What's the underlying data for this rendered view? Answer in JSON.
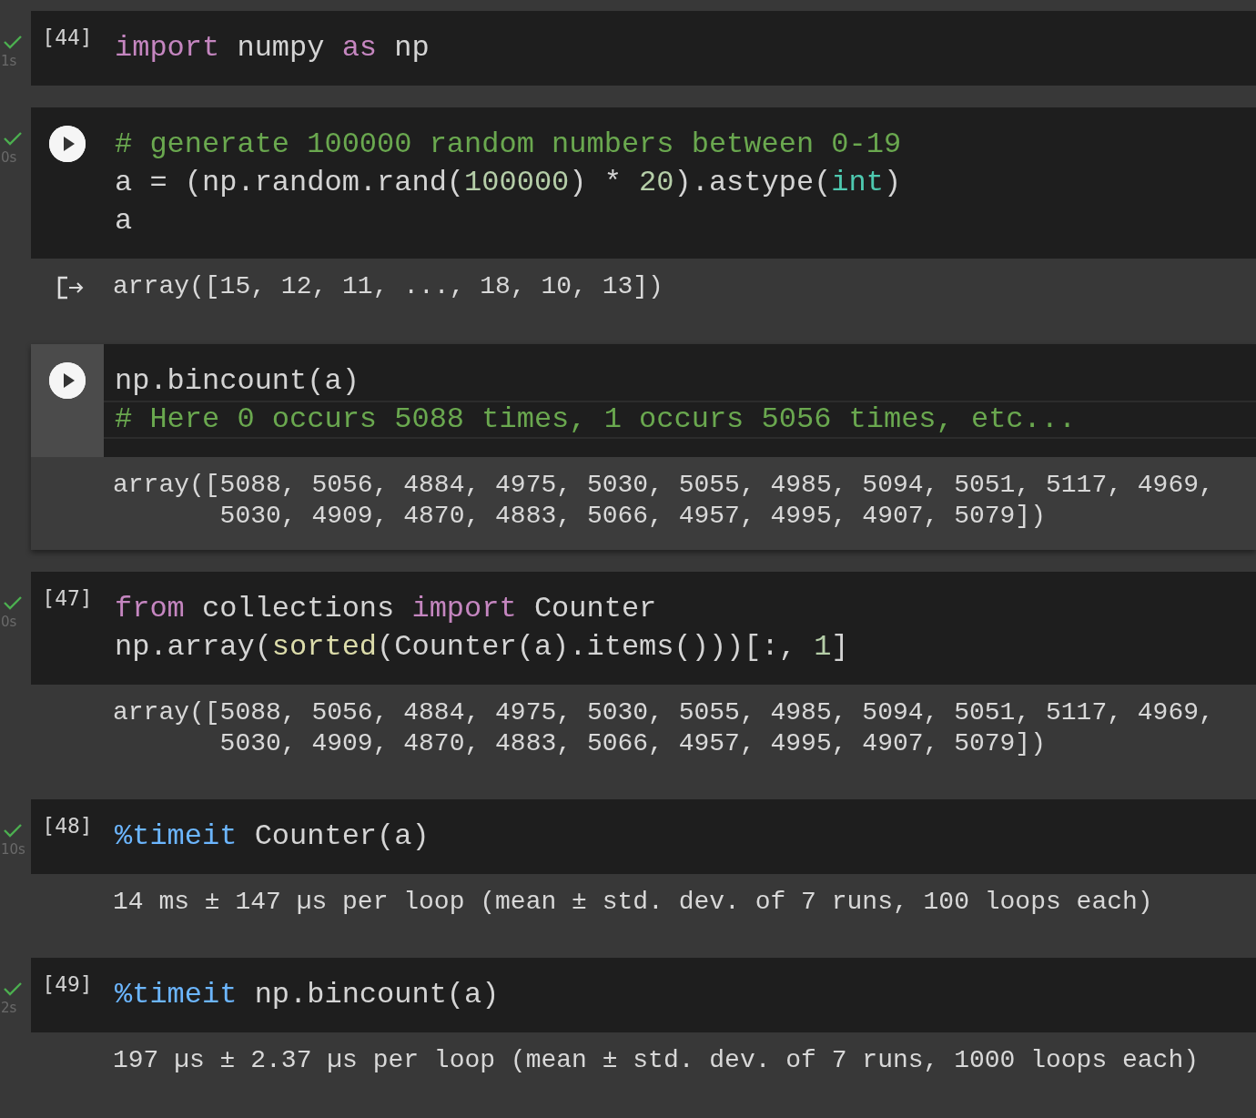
{
  "cells": [
    {
      "kind": "count",
      "count": "[44]",
      "done": true,
      "time": "1s",
      "focused": false,
      "code": [
        {
          "current": false,
          "tokens": [
            {
              "t": "import",
              "kind": "kw"
            },
            {
              "t": " numpy ",
              "kind": "plain"
            },
            {
              "t": "as",
              "kind": "kw"
            },
            {
              "t": " np",
              "kind": "plain"
            }
          ]
        }
      ]
    },
    {
      "kind": "run",
      "done": true,
      "time": "0s",
      "focused": false,
      "code": [
        {
          "current": false,
          "tokens": [
            {
              "t": "# generate 100000 random numbers between 0-19",
              "kind": "comment"
            }
          ]
        },
        {
          "current": false,
          "tokens": [
            {
              "t": "a = (np.random.rand(",
              "kind": "plain"
            },
            {
              "t": "100000",
              "kind": "num"
            },
            {
              "t": ") * ",
              "kind": "plain"
            },
            {
              "t": "20",
              "kind": "num"
            },
            {
              "t": ").astype(",
              "kind": "plain"
            },
            {
              "t": "int",
              "kind": "builtin"
            },
            {
              "t": ")",
              "kind": "plain"
            }
          ]
        },
        {
          "current": false,
          "tokens": [
            {
              "t": "a",
              "kind": "plain"
            }
          ]
        }
      ],
      "output": {
        "icon": true,
        "lines": [
          "array([15, 12, 11, ..., 18, 10, 13])"
        ]
      }
    },
    {
      "kind": "run",
      "done": false,
      "focused": true,
      "code": [
        {
          "current": false,
          "tokens": [
            {
              "t": "np.bincount(a)",
              "kind": "plain"
            }
          ]
        },
        {
          "current": true,
          "tokens": [
            {
              "t": "# Here 0 occurs 5088 times, 1 occurs 5056 times, etc...",
              "kind": "comment"
            }
          ]
        }
      ],
      "output": {
        "icon": false,
        "lines": [
          "array([5088, 5056, 4884, 4975, 5030, 5055, 4985, 5094, 5051, 5117, 4969,",
          "       5030, 4909, 4870, 4883, 5066, 4957, 4995, 4907, 5079])"
        ]
      }
    },
    {
      "kind": "count",
      "count": "[47]",
      "done": true,
      "time": "0s",
      "focused": false,
      "code": [
        {
          "current": false,
          "tokens": [
            {
              "t": "from",
              "kind": "kw"
            },
            {
              "t": " collections ",
              "kind": "plain"
            },
            {
              "t": "import",
              "kind": "kw"
            },
            {
              "t": " Counter",
              "kind": "plain"
            }
          ]
        },
        {
          "current": false,
          "tokens": [
            {
              "t": "np.array(",
              "kind": "plain"
            },
            {
              "t": "sorted",
              "kind": "func"
            },
            {
              "t": "(Counter(a).items()))[:, ",
              "kind": "plain"
            },
            {
              "t": "1",
              "kind": "num"
            },
            {
              "t": "]",
              "kind": "plain"
            }
          ]
        }
      ],
      "output": {
        "icon": false,
        "lines": [
          "array([5088, 5056, 4884, 4975, 5030, 5055, 4985, 5094, 5051, 5117, 4969,",
          "       5030, 4909, 4870, 4883, 5066, 4957, 4995, 4907, 5079])"
        ]
      }
    },
    {
      "kind": "count",
      "count": "[48]",
      "done": true,
      "time": "10s",
      "focused": false,
      "code": [
        {
          "current": false,
          "tokens": [
            {
              "t": "%timeit",
              "kind": "magic"
            },
            {
              "t": " Counter(a)",
              "kind": "plain"
            }
          ]
        }
      ],
      "output": {
        "icon": false,
        "lines": [
          "14 ms ± 147 µs per loop (mean ± std. dev. of 7 runs, 100 loops each)"
        ]
      }
    },
    {
      "kind": "count",
      "count": "[49]",
      "done": true,
      "time": "2s",
      "focused": false,
      "code": [
        {
          "current": false,
          "tokens": [
            {
              "t": "%timeit",
              "kind": "magic"
            },
            {
              "t": " np.bincount(a)",
              "kind": "plain"
            }
          ]
        }
      ],
      "output": {
        "icon": false,
        "lines": [
          "197 µs ± 2.37 µs per loop (mean ± std. dev. of 7 runs, 1000 loops each)"
        ]
      }
    }
  ]
}
